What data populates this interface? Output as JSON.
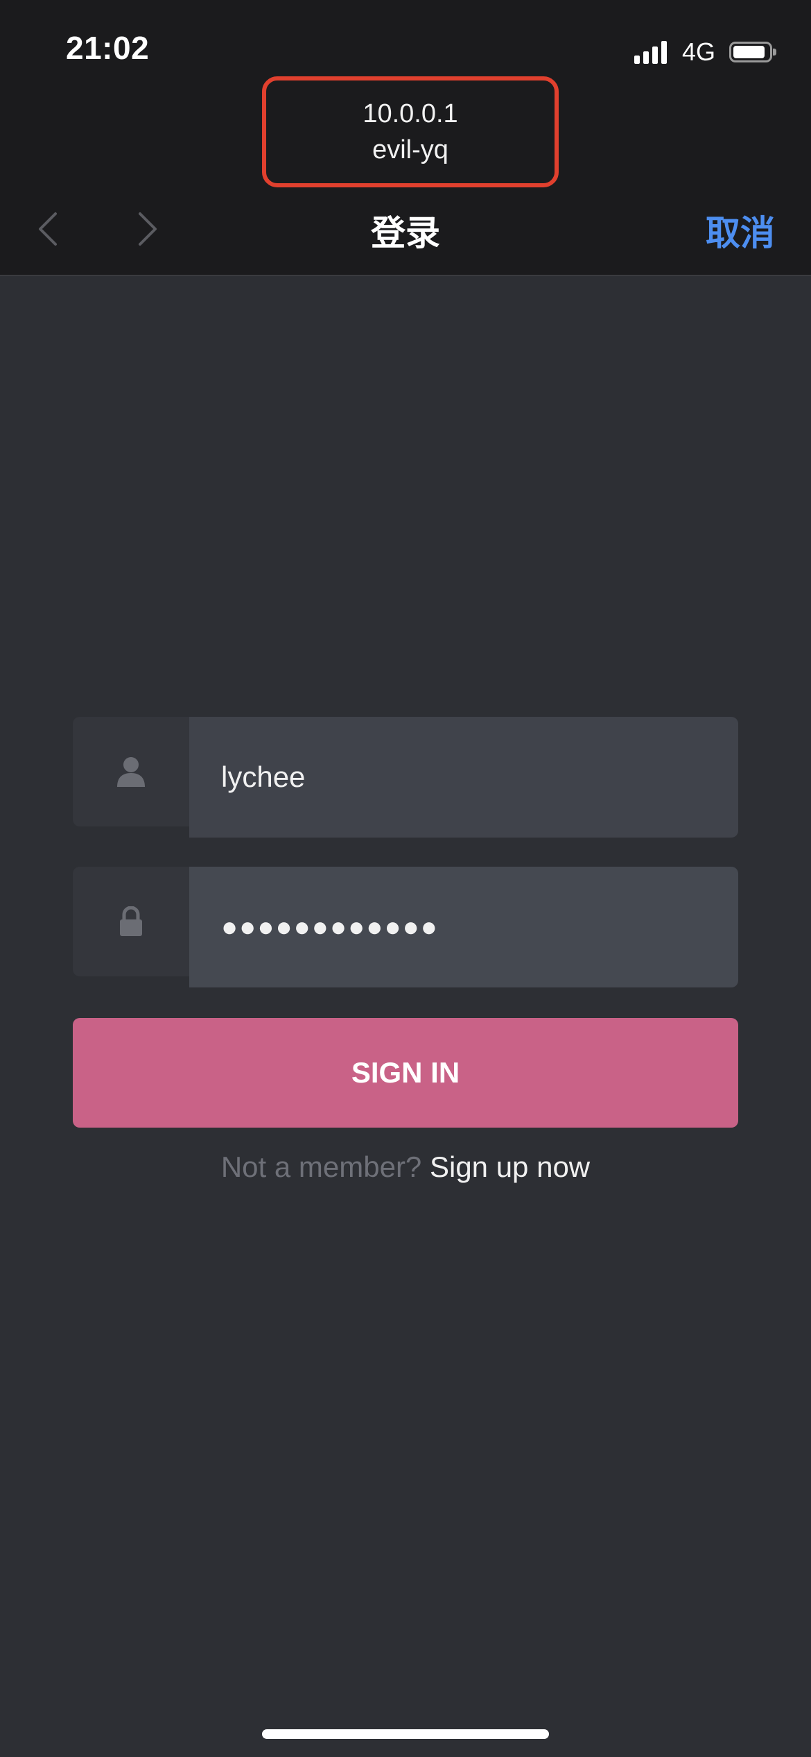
{
  "status_bar": {
    "time": "21:02",
    "network": "4G"
  },
  "browser": {
    "host": "10.0.0.1",
    "site_name": "evil-yq",
    "title": "登录",
    "cancel_label": "取消"
  },
  "login_form": {
    "username_value": "lychee",
    "password_masked": "●●●●●●●●●●●●",
    "sign_in_label": "SIGN IN",
    "signup_prompt": "Not a member?",
    "signup_link": "Sign up now"
  },
  "colors": {
    "background": "#2d2f34",
    "top_bar": "#1b1b1d",
    "accent_blue": "#4d8ef0",
    "sign_in_pink": "#c96287",
    "highlight_red": "#e1402e"
  },
  "icons": {
    "username": "user-icon",
    "password": "lock-icon",
    "back": "chevron-left-icon",
    "forward": "chevron-right-icon"
  }
}
